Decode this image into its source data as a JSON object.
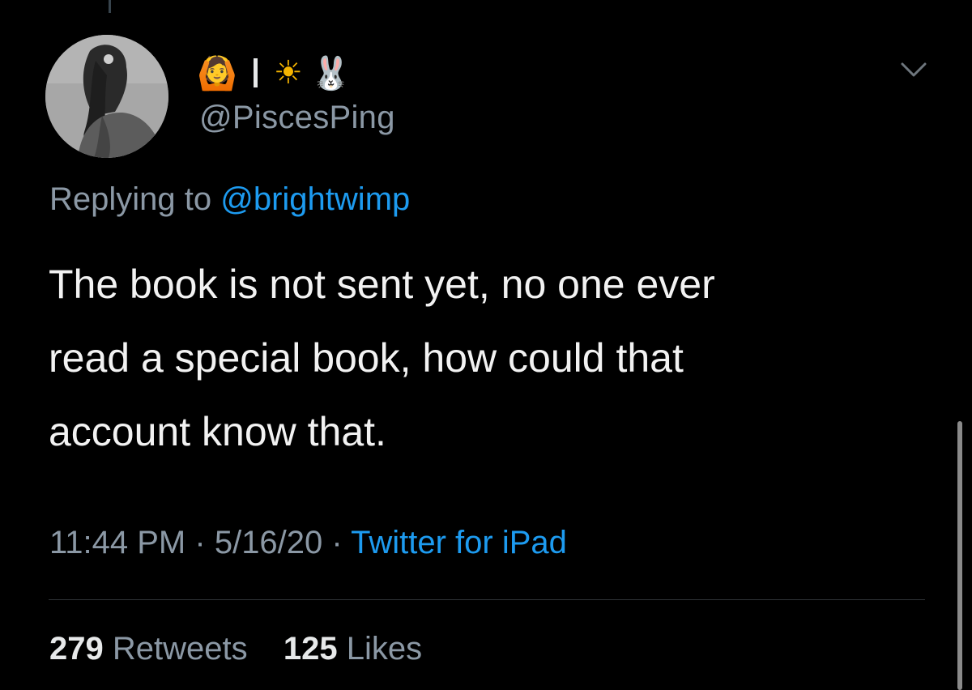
{
  "tweet": {
    "author": {
      "display_name": [
        "🙆",
        "I",
        "☀",
        "🐰"
      ],
      "handle": "@PiscesPing"
    },
    "reply": {
      "prefix": "Replying to",
      "mention": "@brightwimp"
    },
    "text_lines": [
      "The book is not sent yet, no one ever",
      "read a special book, how could that",
      "account know that."
    ],
    "meta": {
      "time": "11:44 PM",
      "separator": "·",
      "date": "5/16/20",
      "source": "Twitter for iPad"
    },
    "stats": {
      "retweets_count": "279",
      "retweets_label": "Retweets",
      "likes_count": "125",
      "likes_label": "Likes"
    }
  },
  "icons": {
    "more": "chevron-down-icon",
    "avatar": "avatar"
  },
  "colors": {
    "background": "#000000",
    "primary_text": "#e7e9ea",
    "secondary_text": "#8b98a5",
    "link": "#1d9bf0",
    "divider": "#2f3336"
  }
}
